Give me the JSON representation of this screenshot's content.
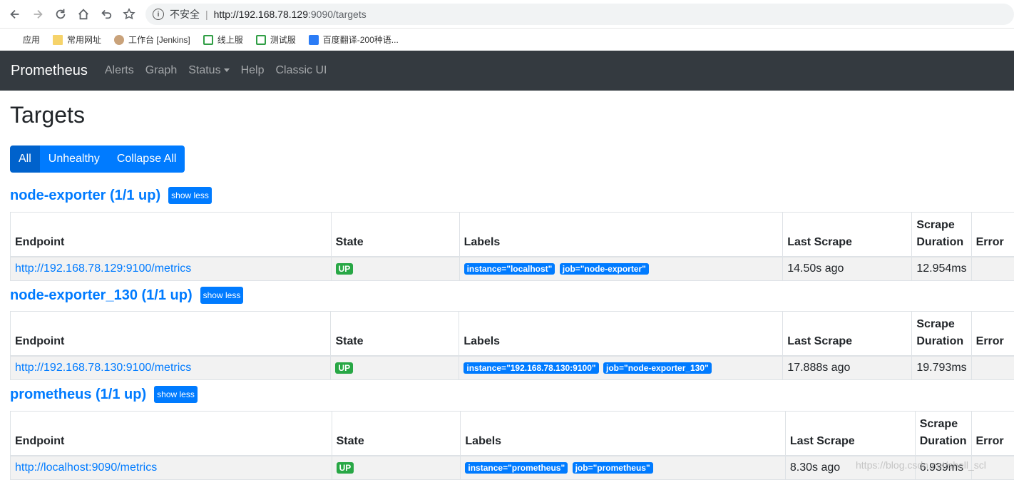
{
  "browser": {
    "insecure_text": "不安全",
    "url_host": "http://192.168.78.129",
    "url_rest": ":9090/targets",
    "bookmarks": [
      {
        "label": "应用"
      },
      {
        "label": "常用网址"
      },
      {
        "label": "工作台 [Jenkins]"
      },
      {
        "label": "线上服"
      },
      {
        "label": "测试服"
      },
      {
        "label": "百度翻译-200种语..."
      }
    ]
  },
  "navbar": {
    "brand": "Prometheus",
    "links": [
      "Alerts",
      "Graph",
      "Status",
      "Help",
      "Classic UI"
    ]
  },
  "page": {
    "title": "Targets",
    "filters": [
      "All",
      "Unhealthy",
      "Collapse All"
    ]
  },
  "table_headers": {
    "endpoint": "Endpoint",
    "state": "State",
    "labels": "Labels",
    "last_scrape": "Last Scrape",
    "duration": "Scrape Duration",
    "error": "Error"
  },
  "pools": [
    {
      "title": "node-exporter (1/1 up)",
      "toggle": "show less",
      "endpoint": "http://192.168.78.129:9100/metrics",
      "state": "UP",
      "labels": [
        "instance=\"localhost\"",
        "job=\"node-exporter\""
      ],
      "last_scrape": "14.50s ago",
      "duration": "12.954ms",
      "error": ""
    },
    {
      "title": "node-exporter_130 (1/1 up)",
      "toggle": "show less",
      "endpoint": "http://192.168.78.130:9100/metrics",
      "state": "UP",
      "labels": [
        "instance=\"192.168.78.130:9100\"",
        "job=\"node-exporter_130\""
      ],
      "last_scrape": "17.888s ago",
      "duration": "19.793ms",
      "error": ""
    },
    {
      "title": "prometheus (1/1 up)",
      "toggle": "show less",
      "endpoint": "http://localhost:9090/metrics",
      "state": "UP",
      "labels": [
        "instance=\"prometheus\"",
        "job=\"prometheus\""
      ],
      "last_scrape": "8.30s ago",
      "duration": "6.939ms",
      "error": ""
    }
  ],
  "watermark": "https://blog.csdn.net/shell_scl"
}
